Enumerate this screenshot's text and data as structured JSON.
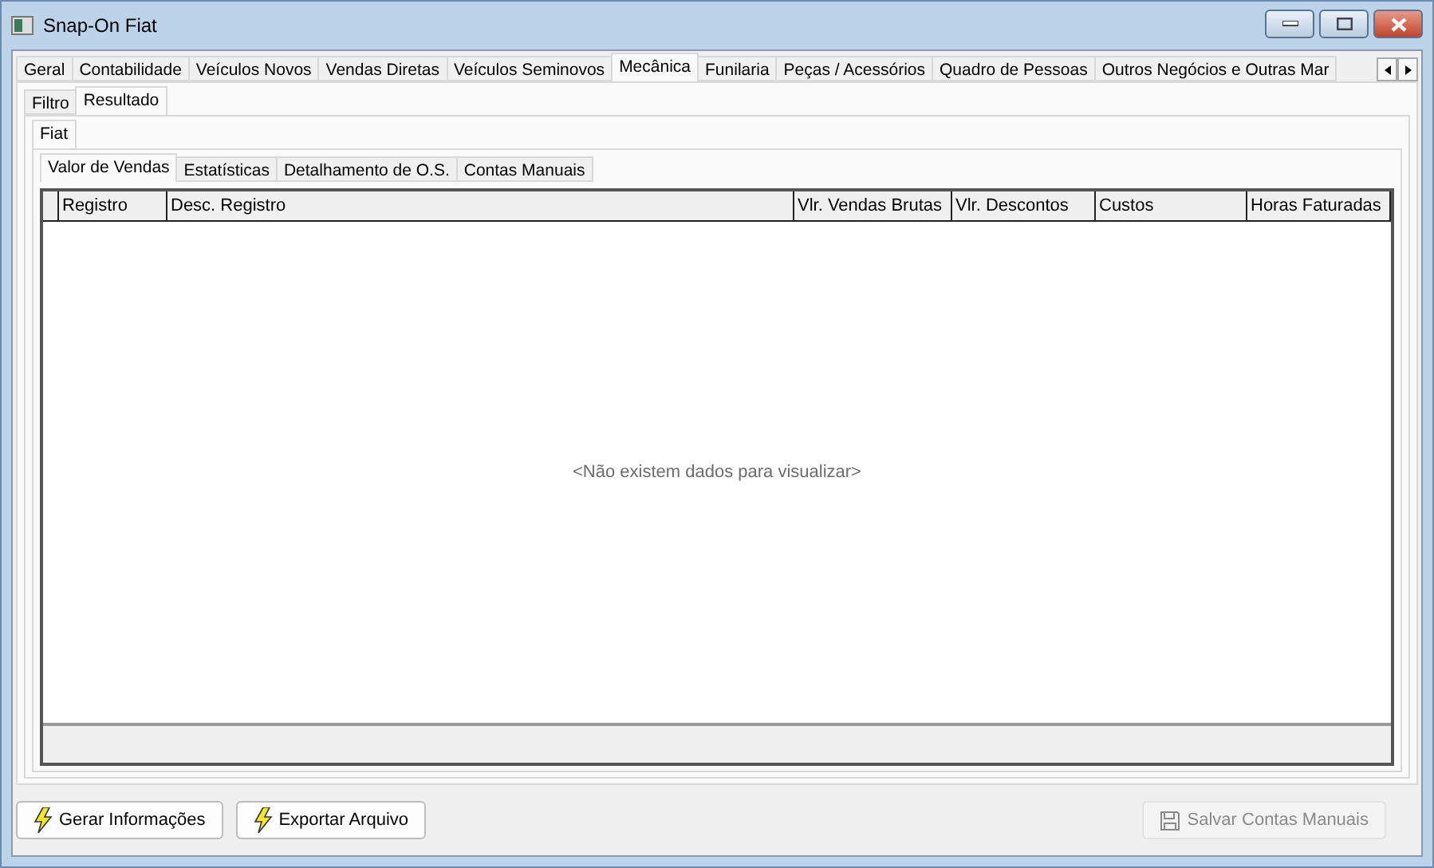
{
  "window": {
    "title": "Snap-On Fiat"
  },
  "tabs": [
    {
      "label": "Geral",
      "selected": false
    },
    {
      "label": "Contabilidade",
      "selected": false
    },
    {
      "label": "Veículos Novos",
      "selected": false
    },
    {
      "label": "Vendas Diretas",
      "selected": false
    },
    {
      "label": "Veículos Seminovos",
      "selected": false
    },
    {
      "label": "Mecânica",
      "selected": true
    },
    {
      "label": "Funilaria",
      "selected": false
    },
    {
      "label": "Peças / Acessórios",
      "selected": false
    },
    {
      "label": "Quadro de Pessoas",
      "selected": false
    },
    {
      "label": "Outros Negócios e Outras Mar",
      "selected": false
    }
  ],
  "sub_tabs": [
    {
      "label": "Filtro",
      "selected": false
    },
    {
      "label": "Resultado",
      "selected": true
    }
  ],
  "brand_tabs": [
    {
      "label": "Fiat",
      "selected": true
    }
  ],
  "report_tabs": [
    {
      "label": "Valor de Vendas",
      "selected": true
    },
    {
      "label": "Estatísticas",
      "selected": false
    },
    {
      "label": "Detalhamento de O.S.",
      "selected": false
    },
    {
      "label": "Contas Manuais",
      "selected": false
    }
  ],
  "table": {
    "columns": [
      "Registro",
      "Desc. Registro",
      "Vlr. Vendas Brutas",
      "Vlr. Descontos",
      "Custos",
      "Horas Faturadas"
    ],
    "empty_message": "<Não existem dados para visualizar>"
  },
  "buttons": [
    {
      "label": "Gerar Informações",
      "kind": "bolt",
      "disabled": false
    },
    {
      "label": "Exportar Arquivo",
      "kind": "bolt",
      "disabled": false
    },
    {
      "label": "Salvar Contas Manuais",
      "kind": "save",
      "disabled": true
    }
  ]
}
